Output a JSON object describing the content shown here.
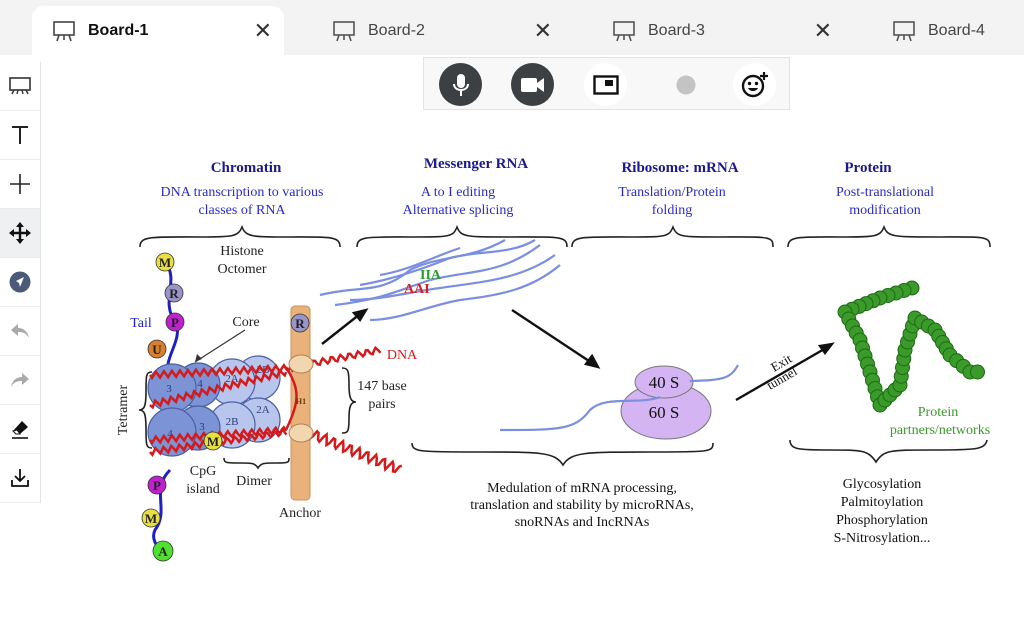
{
  "tabs": [
    {
      "label": "Board-1",
      "active": true,
      "icon": "whiteboard-icon"
    },
    {
      "label": "Board-2",
      "active": false,
      "icon": "whiteboard-icon"
    },
    {
      "label": "Board-3",
      "active": false,
      "icon": "whiteboard-icon"
    },
    {
      "label": "Board-4",
      "active": false,
      "icon": "whiteboard-icon"
    }
  ],
  "close_glyph": "✕",
  "toolbar": {
    "items": [
      "presentation-icon",
      "text-icon",
      "plus-icon",
      "move-icon",
      "pointer-icon",
      "undo-icon",
      "redo-icon",
      "eraser-icon",
      "download-icon"
    ],
    "selected": "move-icon"
  },
  "media": {
    "buttons": [
      "microphone-icon",
      "video-camera-icon",
      "screen-share-icon",
      "status-dot-icon",
      "emoji-add-icon"
    ]
  },
  "diagram": {
    "sections": [
      {
        "title": "Chromatin",
        "sub1": "DNA transcription to various",
        "sub2": "classes of RNA"
      },
      {
        "title": "Messenger RNA",
        "sub1": "A to I editing",
        "sub2": "Alternative splicing"
      },
      {
        "title": "Ribosome: mRNA",
        "sub1": "Translation/Protein",
        "sub2": "folding"
      },
      {
        "title": "Protein",
        "sub1": "Post-translational",
        "sub2": "modification"
      }
    ],
    "histone_1": "Histone",
    "histone_2": "Octomer",
    "tail": "Tail",
    "core": "Core",
    "tetramer": "Tetramer",
    "dimer": "Dimer",
    "cpg_1": "CpG",
    "cpg_2": "island",
    "anchor": "Anchor",
    "h1": "H1",
    "dna": "DNA",
    "bp_1": "147 base",
    "bp_2": "pairs",
    "histones": [
      "3",
      "4",
      "2A",
      "2B",
      "4",
      "3",
      "2B",
      "2A"
    ],
    "marks": [
      "M",
      "R",
      "P",
      "U",
      "P",
      "M",
      "A",
      "R",
      "M"
    ],
    "editing_top": "IIA",
    "editing_bottom": "AAI",
    "ribo_small": "40 S",
    "ribo_large": "60 S",
    "exit_1": "Exit",
    "exit_2": "tunnel",
    "partners_1": "Protein",
    "partners_2": "partners/networks",
    "modulation": [
      "Medulation of mRNA processing,",
      "translation and stability by microRNAs,",
      "snoRNAs and IncRNAs"
    ],
    "ptm": [
      "Glycosylation",
      "Palmitoylation",
      "Phosphorylation",
      "S-Nitrosylation..."
    ],
    "colors": {
      "title": "#1a1a8c",
      "subtitle": "#2a2acc",
      "dna": "#d41a1a",
      "rna": "#7b8fe0",
      "histone": "#7c93d6",
      "ribosome": "#d4b4f2",
      "protein": "#3a9a2a",
      "anchor": "#e9b27a"
    }
  }
}
